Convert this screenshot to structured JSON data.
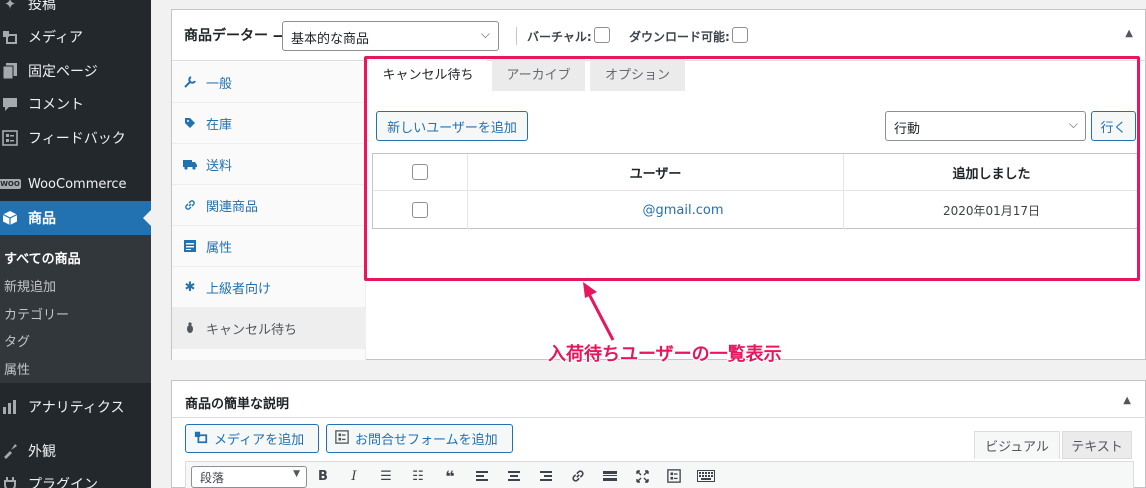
{
  "sidebar": {
    "items": [
      {
        "label": "投稿",
        "icon": "pushpin-icon"
      },
      {
        "label": "メディア",
        "icon": "media-icon"
      },
      {
        "label": "固定ページ",
        "icon": "page-icon"
      },
      {
        "label": "コメント",
        "icon": "comment-icon"
      },
      {
        "label": "フィードバック",
        "icon": "feedback-icon"
      },
      {
        "label": "WooCommerce",
        "icon": "woocommerce-icon",
        "badge": "WOO"
      },
      {
        "label": "商品",
        "icon": "product-icon"
      },
      {
        "label": "アナリティクス",
        "icon": "analytics-icon"
      },
      {
        "label": "外観",
        "icon": "appearance-icon"
      },
      {
        "label": "プラグイン",
        "icon": "plugin-icon"
      }
    ],
    "submenu": [
      "すべての商品",
      "新規追加",
      "カテゴリー",
      "タグ",
      "属性"
    ],
    "accent": "#2271b1"
  },
  "product_data": {
    "title": "商品データー —",
    "type_select": "基本的な商品",
    "virtual_label": "バーチャル:",
    "downloadable_label": "ダウンロード可能:",
    "tabs": [
      {
        "label": "一般",
        "icon": "wrench-icon"
      },
      {
        "label": "在庫",
        "icon": "tag-icon"
      },
      {
        "label": "送料",
        "icon": "truck-icon"
      },
      {
        "label": "関連商品",
        "icon": "link-icon"
      },
      {
        "label": "属性",
        "icon": "list-icon"
      },
      {
        "label": "上級者向け",
        "icon": "gear-icon"
      },
      {
        "label": "キャンセル待ち",
        "icon": "bug-icon"
      }
    ]
  },
  "waitlist": {
    "tabs": [
      "キャンセル待ち",
      "アーカイブ",
      "オプション"
    ],
    "add_user_button": "新しいユーザーを追加",
    "bulk_action_select": "行動",
    "apply_button": "行く",
    "columns": [
      "ユーザー",
      "追加しました"
    ],
    "rows": [
      {
        "user": "@gmail.com",
        "date": "2020年01月17日"
      }
    ]
  },
  "annotation": {
    "text": "入荷待ちユーザーの一覧表示",
    "color": "#e8175d"
  },
  "short_description": {
    "title": "商品の簡単な説明",
    "add_media_button": "メディアを追加",
    "add_form_button": "お問合せフォームを追加",
    "visual_tab": "ビジュアル",
    "text_tab": "テキスト",
    "format_select": "段落",
    "toolbar_icons": [
      "bold-icon",
      "italic-icon",
      "bullet-list-icon",
      "numbered-list-icon",
      "blockquote-icon",
      "align-left-icon",
      "align-center-icon",
      "align-right-icon",
      "link-icon",
      "more-icon",
      "fullscreen-icon",
      "form-icon",
      "keyboard-icon"
    ]
  }
}
